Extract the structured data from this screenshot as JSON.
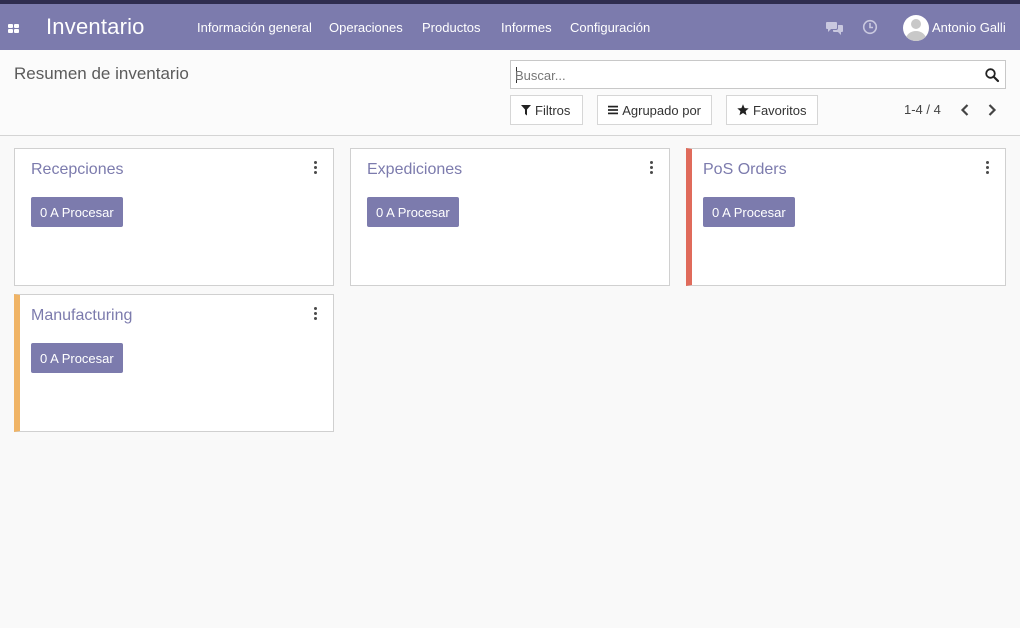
{
  "app": {
    "title": "Inventario",
    "apps_icon": "grid-apps-icon"
  },
  "menu": [
    {
      "label": "Información general"
    },
    {
      "label": "Operaciones"
    },
    {
      "label": "Productos"
    },
    {
      "label": "Informes"
    },
    {
      "label": "Configuración"
    }
  ],
  "systray": {
    "chat_icon": "chat-bubbles-icon",
    "activity_icon": "clock-icon",
    "user_name": "Antonio Galli"
  },
  "control_panel": {
    "title": "Resumen de inventario",
    "search": {
      "value": "",
      "placeholder": "Buscar..."
    },
    "filters_label": "Filtros",
    "group_by_label": "Agrupado por",
    "favorites_label": "Favoritos",
    "pager": "1-4 / 4"
  },
  "cards": [
    {
      "title": "Recepciones",
      "button": "0 A Procesar",
      "accent": ""
    },
    {
      "title": "Expediciones",
      "button": "0 A Procesar",
      "accent": ""
    },
    {
      "title": "PoS Orders",
      "button": "0 A Procesar",
      "accent": "#e06b5b"
    },
    {
      "title": "Manufacturing",
      "button": "0 A Procesar",
      "accent": "#f0b466"
    }
  ],
  "colors": {
    "navbar": "#7c7bad",
    "primary_button": "#7c7bad"
  }
}
